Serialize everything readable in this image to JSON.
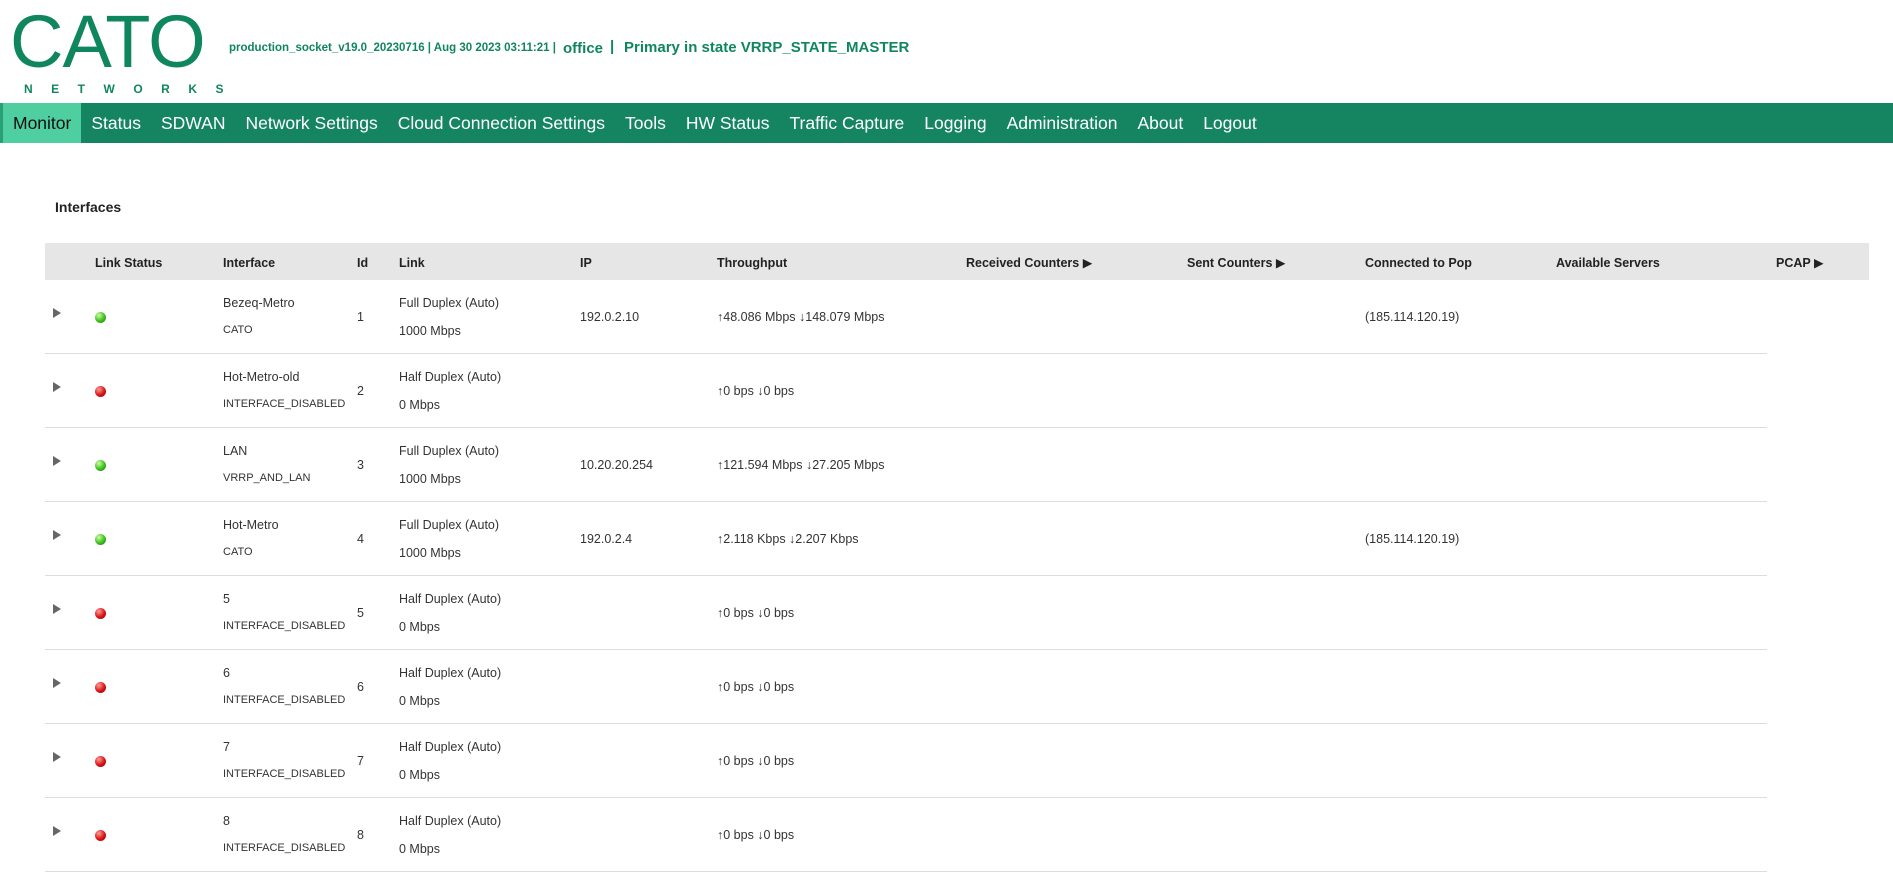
{
  "header": {
    "logo": "CATO",
    "logo_sub": "NETWORKS",
    "build": "production_socket_v19.0_20230716 | Aug 30 2023 03:11:21 |",
    "site": "office",
    "separator": "|",
    "state": "Primary in state VRRP_STATE_MASTER"
  },
  "nav": [
    "Monitor",
    "Status",
    "SDWAN",
    "Network Settings",
    "Cloud Connection Settings",
    "Tools",
    "HW Status",
    "Traffic Capture",
    "Logging",
    "Administration",
    "About",
    "Logout"
  ],
  "section_title": "Interfaces",
  "columns": {
    "link_status": "Link Status",
    "interface": "Interface",
    "id": "Id",
    "link": "Link",
    "ip": "IP",
    "throughput": "Throughput",
    "received": "Received Counters ▶",
    "sent": "Sent Counters ▶",
    "pop": "Connected to Pop",
    "servers": "Available Servers",
    "pcap": "PCAP ▶"
  },
  "rows": [
    {
      "status": "green",
      "name": "Bezeq-Metro",
      "sub": "CATO",
      "id": "1",
      "duplex": "Full Duplex (Auto)",
      "speed": "1000 Mbps",
      "ip": "192.0.2.10",
      "throughput": "↑48.086 Mbps ↓148.079 Mbps",
      "pop": "(185.114.120.19)"
    },
    {
      "status": "red",
      "name": "Hot-Metro-old",
      "sub": "INTERFACE_DISABLED",
      "id": "2",
      "duplex": "Half Duplex (Auto)",
      "speed": "0 Mbps",
      "ip": "",
      "throughput": "↑0 bps ↓0 bps",
      "pop": ""
    },
    {
      "status": "green",
      "name": "LAN",
      "sub": "VRRP_AND_LAN",
      "id": "3",
      "duplex": "Full Duplex (Auto)",
      "speed": "1000 Mbps",
      "ip": "10.20.20.254",
      "throughput": "↑121.594 Mbps ↓27.205 Mbps",
      "pop": ""
    },
    {
      "status": "green",
      "name": "Hot-Metro",
      "sub": "CATO",
      "id": "4",
      "duplex": "Full Duplex (Auto)",
      "speed": "1000 Mbps",
      "ip": "192.0.2.4",
      "throughput": "↑2.118 Kbps ↓2.207 Kbps",
      "pop": "(185.114.120.19)"
    },
    {
      "status": "red",
      "name": "5",
      "sub": "INTERFACE_DISABLED",
      "id": "5",
      "duplex": "Half Duplex (Auto)",
      "speed": "0 Mbps",
      "ip": "",
      "throughput": "↑0 bps ↓0 bps",
      "pop": ""
    },
    {
      "status": "red",
      "name": "6",
      "sub": "INTERFACE_DISABLED",
      "id": "6",
      "duplex": "Half Duplex (Auto)",
      "speed": "0 Mbps",
      "ip": "",
      "throughput": "↑0 bps ↓0 bps",
      "pop": ""
    },
    {
      "status": "red",
      "name": "7",
      "sub": "INTERFACE_DISABLED",
      "id": "7",
      "duplex": "Half Duplex (Auto)",
      "speed": "0 Mbps",
      "ip": "",
      "throughput": "↑0 bps ↓0 bps",
      "pop": ""
    },
    {
      "status": "red",
      "name": "8",
      "sub": "INTERFACE_DISABLED",
      "id": "8",
      "duplex": "Half Duplex (Auto)",
      "speed": "0 Mbps",
      "ip": "",
      "throughput": "↑0 bps ↓0 bps",
      "pop": ""
    }
  ],
  "colors": {
    "brand": "#10865e",
    "nav_bg": "#158460",
    "nav_active": "#4fcf9f",
    "status_up": "#3dbd1f",
    "status_down": "#d91313"
  }
}
